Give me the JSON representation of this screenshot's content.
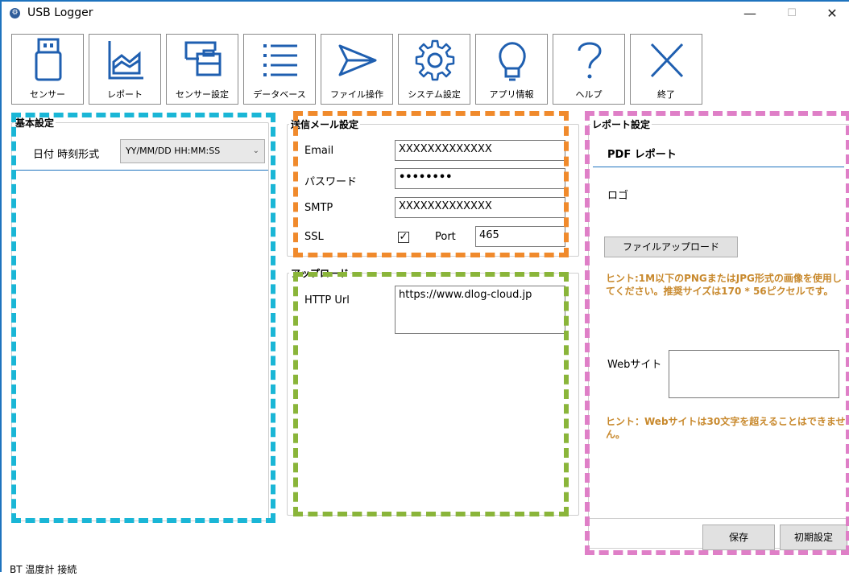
{
  "window": {
    "title": "USB Logger",
    "controls": {
      "minimize": "—",
      "maximize": "☐",
      "close": "✕"
    }
  },
  "toolbar": {
    "items": [
      {
        "label": "センサー",
        "icon": "usb-drive-icon"
      },
      {
        "label": "レポート",
        "icon": "chart-icon"
      },
      {
        "label": "センサー設定",
        "icon": "sensor-settings-icon"
      },
      {
        "label": "データベース",
        "icon": "list-icon"
      },
      {
        "label": "ファイル操作",
        "icon": "send-icon"
      },
      {
        "label": "システム設定",
        "icon": "gear-icon"
      },
      {
        "label": "アプリ情報",
        "icon": "lightbulb-icon"
      },
      {
        "label": "ヘルプ",
        "icon": "question-icon"
      },
      {
        "label": "終了",
        "icon": "close-icon"
      }
    ]
  },
  "basic": {
    "title": "基本設定",
    "date_format_label": "日付 時刻形式",
    "date_format_value": "YY/MM/DD HH:MM:SS"
  },
  "mail": {
    "title": "送信メール設定",
    "email_label": "Email",
    "email_value": "XXXXXXXXXXXXX",
    "password_label": "パスワード",
    "password_value": "••••••••",
    "smtp_label": "SMTP",
    "smtp_value": "XXXXXXXXXXXXX",
    "ssl_label": "SSL",
    "ssl_checked": "✓",
    "port_label": "Port",
    "port_value": "465"
  },
  "upload": {
    "title": "アップロード",
    "http_label": "HTTP Url",
    "http_value": "https://www.dlog-cloud.jp"
  },
  "report": {
    "title": "レポート設定",
    "pdf_title": "PDF レポート",
    "logo_label": "ロゴ",
    "file_upload_button": "ファイルアップロード",
    "hint_image": "ヒント:1M以下のPNGまたはJPG形式の画像を使用してください。推奨サイズは170 * 56ピクセルです。",
    "website_label": "Webサイト",
    "website_value": "",
    "hint_website": "ヒント：Webサイトは30文字を超えることはできません。",
    "save_button": "保存",
    "reset_button": "初期設定"
  },
  "status": {
    "text": "BT 温度計 接続"
  },
  "colors": {
    "cyan_dash": "#1ab6d6",
    "orange_dash": "#f08a2c",
    "green_dash": "#8ab53a",
    "pink_dash": "#df7fc7",
    "hint": "#c8892d",
    "accent": "#1e73be"
  }
}
